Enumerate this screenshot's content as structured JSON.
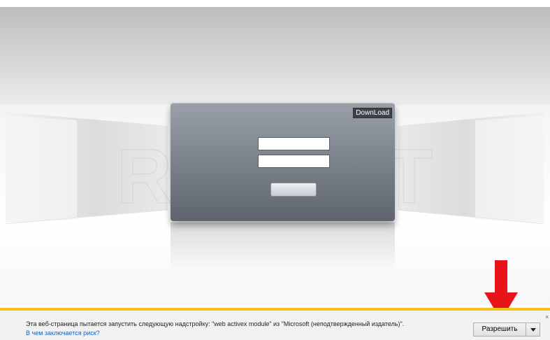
{
  "login_panel": {
    "download_label": "DownLoad",
    "watermark_text": "REXANT"
  },
  "notification": {
    "message": "Эта веб-страница пытается запустить следующую надстройку: \"web activex  module\" из \"Microsoft (неподтвержденный издатель)\".",
    "risk_link": "В чем заключается риск?",
    "allow_label": "Разрешить",
    "close_glyph": "×"
  },
  "colors": {
    "panel_top": "#9aa0a8",
    "panel_bottom": "#5f656e",
    "notification_accent": "#f5c21c",
    "annotation_arrow": "#e8141a",
    "link": "#1a5fb4"
  },
  "icons": {
    "dropdown": "chevron-down-icon",
    "annotation": "red-arrow-down"
  }
}
